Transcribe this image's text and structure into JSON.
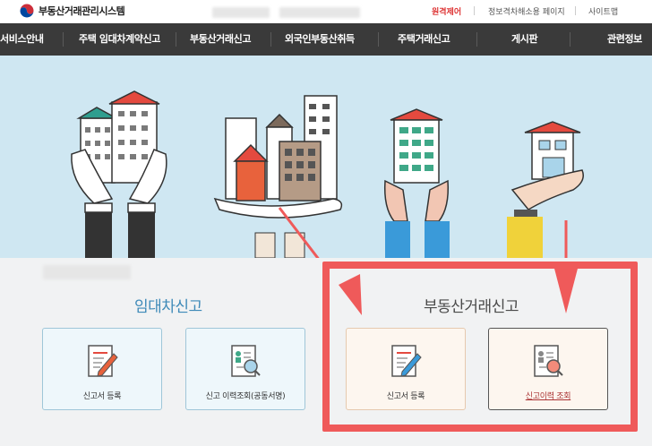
{
  "header": {
    "logo_text": "부동산거래관리시스템",
    "links": [
      "원격제어",
      "정보격차해소용 페이지",
      "사이트맵"
    ]
  },
  "nav": {
    "items": [
      "서비스안내",
      "주택 임대차계약신고",
      "부동산거래신고",
      "외국인부동산취득",
      "주택거래신고",
      "게시판",
      "관련정보"
    ]
  },
  "sections": {
    "lease": {
      "title": "임대차신고",
      "cards": [
        "신고서 등록",
        "신고 이력조회(공동서명)"
      ]
    },
    "realestate": {
      "title": "부동산거래신고",
      "cards": [
        "신고서 등록",
        "신고이력 조회"
      ]
    }
  },
  "colors": {
    "nav_bg": "#3a3a3a",
    "hero_bg": "#cfe7f2",
    "highlight_red": "#ef5a5a",
    "lease_title": "#3e8ab8"
  }
}
